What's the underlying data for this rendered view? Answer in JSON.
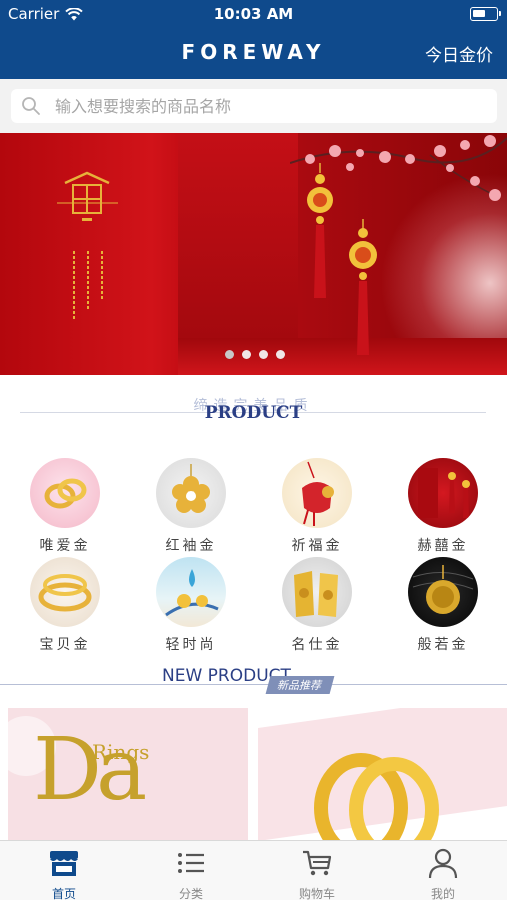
{
  "status_bar": {
    "carrier": "Carrier",
    "time": "10:03 AM"
  },
  "nav": {
    "title": "FOREWAY",
    "right_link": "今日金价"
  },
  "search": {
    "placeholder": "输入想要搜索的商品名称"
  },
  "banner": {
    "slides": 4,
    "active_index": 0
  },
  "product_section": {
    "title_cn": "缔造完美品质",
    "title_en": "PRODUCT"
  },
  "categories": [
    {
      "label": "唯爱金",
      "icon": "ring-pair-photo"
    },
    {
      "label": "红袖金",
      "icon": "flower-pendant-photo"
    },
    {
      "label": "祈福金",
      "icon": "red-pouch-photo"
    },
    {
      "label": "赫囍金",
      "icon": "red-tassel-photo"
    },
    {
      "label": "宝贝金",
      "icon": "baby-bangle-photo"
    },
    {
      "label": "轻时尚",
      "icon": "fashion-charm-photo"
    },
    {
      "label": "名仕金",
      "icon": "gold-plaque-photo"
    },
    {
      "label": "般若金",
      "icon": "buddha-pendant-photo"
    }
  ],
  "new_product": {
    "title_en": "NEW PRODUCT",
    "tag": "新品推荐"
  },
  "cards": [
    {
      "big_text": "Da",
      "sub_text": "Rings"
    },
    {
      "image": "gold-rings-photo"
    }
  ],
  "tabs": [
    {
      "label": "首页",
      "icon": "store-icon",
      "active": true
    },
    {
      "label": "分类",
      "icon": "list-icon",
      "active": false
    },
    {
      "label": "购物车",
      "icon": "cart-icon",
      "active": false
    },
    {
      "label": "我的",
      "icon": "person-icon",
      "active": false
    }
  ],
  "colors": {
    "primary": "#0f4a8c",
    "banner_red": "#c40d14",
    "gold": "#c6a12c"
  }
}
